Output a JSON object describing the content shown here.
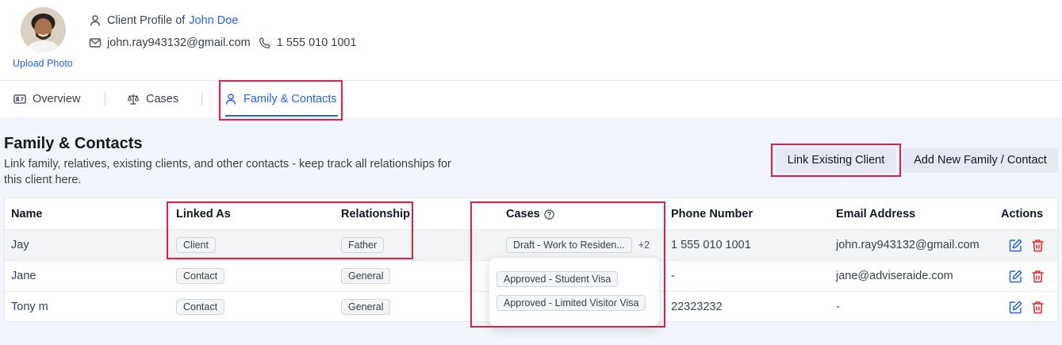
{
  "header": {
    "upload_photo": "Upload Photo",
    "profile_prefix": "Client Profile of",
    "client_name": "John Doe",
    "email": "john.ray943132@gmail.com",
    "phone": "1 555 010 1001"
  },
  "tabs": [
    {
      "label": "Overview",
      "icon": "id-card-icon"
    },
    {
      "label": "Cases",
      "icon": "scale-icon"
    },
    {
      "label": "Family & Contacts",
      "icon": "user-icon",
      "active": true
    }
  ],
  "section": {
    "title": "Family & Contacts",
    "description": "Link family, relatives, existing clients, and other contacts - keep track all relationships for this client here."
  },
  "buttons": {
    "link_existing": "Link Existing Client",
    "add_new": "Add New Family / Contact"
  },
  "table": {
    "columns": {
      "name": "Name",
      "linked_as": "Linked As",
      "relationship": "Relationship",
      "cases": "Cases",
      "phone": "Phone Number",
      "email": "Email Address",
      "actions": "Actions"
    },
    "rows": [
      {
        "name": "Jay",
        "linked_as": "Client",
        "relationship": "Father",
        "case": "Draft - Work to Residen...",
        "more": "+2",
        "phone": "1 555 010 1001",
        "email": "john.ray943132@gmail.com"
      },
      {
        "name": "Jane",
        "linked_as": "Contact",
        "relationship": "General",
        "case": "",
        "more": "",
        "phone": "-",
        "email": "jane@adviseraide.com"
      },
      {
        "name": "Tony m",
        "linked_as": "Contact",
        "relationship": "General",
        "case": "",
        "more": "",
        "phone": "22323232",
        "email": "-"
      }
    ]
  },
  "popover": {
    "cases": [
      "Approved - Student Visa",
      "Approved - Limited Visitor Visa"
    ]
  },
  "colors": {
    "accent": "#2563eb",
    "delete": "#dc2626",
    "highlight": "#e11d48",
    "panel_bg": "#f1f4fb"
  }
}
